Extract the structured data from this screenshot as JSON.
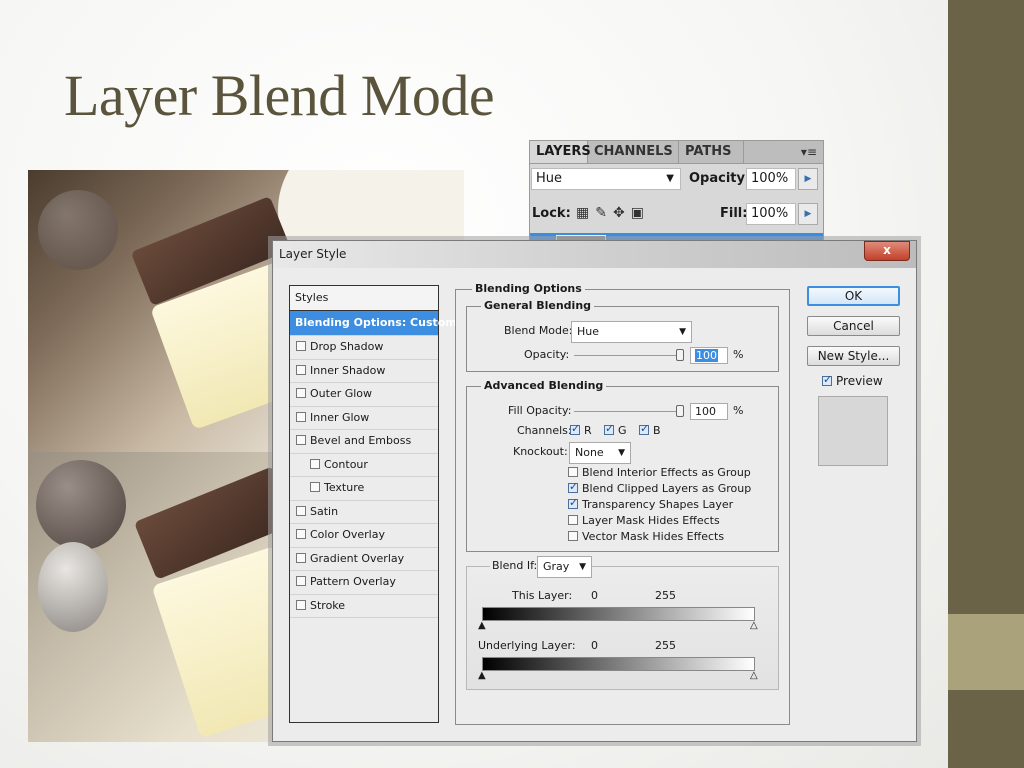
{
  "slide": {
    "title": "Layer Blend Mode",
    "colors": {
      "sidebar_dark": "#6b6347",
      "sidebar_light": "#a9a27a",
      "title": "#5b543c"
    }
  },
  "layers_panel": {
    "tabs": [
      "LAYERS",
      "CHANNELS",
      "PATHS"
    ],
    "menu_icon": "▾≡",
    "blend_mode": "Hue",
    "opacity_label": "Opacity:",
    "opacity_value": "100%",
    "lock_label": "Lock:",
    "fill_label": "Fill:",
    "fill_value": "100%"
  },
  "dialog": {
    "title": "Layer Style",
    "close_label": "x",
    "styles_header": "Styles",
    "style_items": [
      {
        "label": "Blending Options: Custom",
        "active": true,
        "checkbox": false,
        "indent": false
      },
      {
        "label": "Drop Shadow",
        "checkbox": true
      },
      {
        "label": "Inner Shadow",
        "checkbox": true
      },
      {
        "label": "Outer Glow",
        "checkbox": true
      },
      {
        "label": "Inner Glow",
        "checkbox": true
      },
      {
        "label": "Bevel and Emboss",
        "checkbox": true
      },
      {
        "label": "Contour",
        "checkbox": true,
        "indent": true
      },
      {
        "label": "Texture",
        "checkbox": true,
        "indent": true
      },
      {
        "label": "Satin",
        "checkbox": true
      },
      {
        "label": "Color Overlay",
        "checkbox": true
      },
      {
        "label": "Gradient Overlay",
        "checkbox": true
      },
      {
        "label": "Pattern Overlay",
        "checkbox": true
      },
      {
        "label": "Stroke",
        "checkbox": true
      }
    ],
    "blending_options": {
      "title": "Blending Options",
      "general": {
        "title": "General Blending",
        "blend_mode_label": "Blend Mode:",
        "blend_mode_value": "Hue",
        "opacity_label": "Opacity:",
        "opacity_value": "100",
        "opacity_unit": "%"
      },
      "advanced": {
        "title": "Advanced Blending",
        "fill_opacity_label": "Fill Opacity:",
        "fill_opacity_value": "100",
        "fill_opacity_unit": "%",
        "channels_label": "Channels:",
        "channels": [
          {
            "label": "R",
            "checked": true
          },
          {
            "label": "G",
            "checked": true
          },
          {
            "label": "B",
            "checked": true
          }
        ],
        "knockout_label": "Knockout:",
        "knockout_value": "None",
        "options": [
          {
            "label": "Blend Interior Effects as Group",
            "checked": false
          },
          {
            "label": "Blend Clipped Layers as Group",
            "checked": true
          },
          {
            "label": "Transparency Shapes Layer",
            "checked": true
          },
          {
            "label": "Layer Mask Hides Effects",
            "checked": false
          },
          {
            "label": "Vector Mask Hides Effects",
            "checked": false
          }
        ]
      },
      "blend_if": {
        "label": "Blend If:",
        "value": "Gray",
        "this_layer_label": "This Layer:",
        "this_layer_min": "0",
        "this_layer_max": "255",
        "underlying_label": "Underlying Layer:",
        "underlying_min": "0",
        "underlying_max": "255"
      }
    },
    "buttons": {
      "ok": "OK",
      "cancel": "Cancel",
      "new_style": "New Style...",
      "preview_label": "Preview",
      "preview_checked": true
    }
  }
}
